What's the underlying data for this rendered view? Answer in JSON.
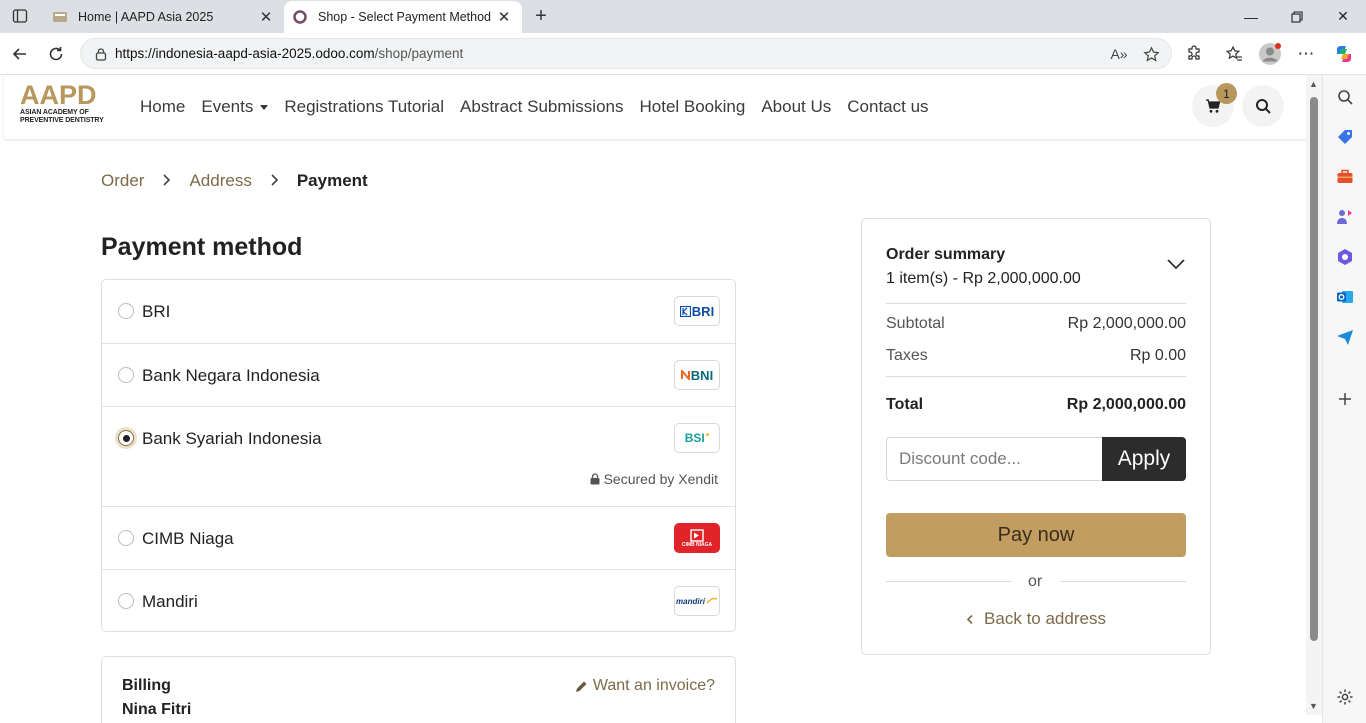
{
  "browser": {
    "tabs": [
      {
        "title": "Home | AAPD Asia 2025",
        "active": false
      },
      {
        "title": "Shop - Select Payment Method | ",
        "active": true
      }
    ],
    "url_host": "https://indonesia-aapd-asia-2025.odoo.com",
    "url_path": "/shop/payment"
  },
  "site": {
    "logo_text": "AAPD",
    "logo_sub1": "ASIAN ACADEMY OF",
    "logo_sub2": "PREVENTIVE DENTISTRY",
    "nav": [
      {
        "label": "Home"
      },
      {
        "label": "Events"
      },
      {
        "label": "Registrations Tutorial"
      },
      {
        "label": "Abstract Submissions"
      },
      {
        "label": "Hotel Booking"
      },
      {
        "label": "About Us"
      },
      {
        "label": "Contact us"
      }
    ],
    "cart_count": "1"
  },
  "breadcrumb": {
    "order": "Order",
    "address": "Address",
    "payment": "Payment"
  },
  "payment": {
    "heading": "Payment method",
    "methods": [
      {
        "name": "BRI",
        "logo": "BRI",
        "logo_color": "#0f4da2",
        "selected": false
      },
      {
        "name": "Bank Negara Indonesia",
        "logo": "BNI",
        "logo_color": "#0a6a7a",
        "selected": false
      },
      {
        "name": "Bank Syariah Indonesia",
        "logo": "BSI",
        "logo_color": "#1a9e9a",
        "selected": true
      },
      {
        "name": "CIMB Niaga",
        "logo": "CIMB NIAGA",
        "logo_color": "#e1232a",
        "selected": false
      },
      {
        "name": "Mandiri",
        "logo": "mandiri",
        "logo_color": "#0d3b7a",
        "selected": false
      }
    ],
    "secured_by": "Secured by Xendit"
  },
  "billing": {
    "title": "Billing",
    "name": "Nina Fitri",
    "invoice_link": "Want an invoice?"
  },
  "summary": {
    "title": "Order summary",
    "items": "1 item(s) -  Rp 2,000,000.00",
    "subtotal_label": "Subtotal",
    "subtotal_value": "Rp 2,000,000.00",
    "taxes_label": "Taxes",
    "taxes_value": "Rp 0.00",
    "total_label": "Total",
    "total_value": "Rp 2,000,000.00",
    "discount_placeholder": "Discount code...",
    "apply_label": "Apply",
    "pay_now_label": "Pay now",
    "or_label": "or",
    "back_label": "Back to address"
  },
  "colors": {
    "brand_gold": "#c19d62",
    "link_brown": "#7d6a49",
    "dark_button": "#2c2c2c"
  }
}
